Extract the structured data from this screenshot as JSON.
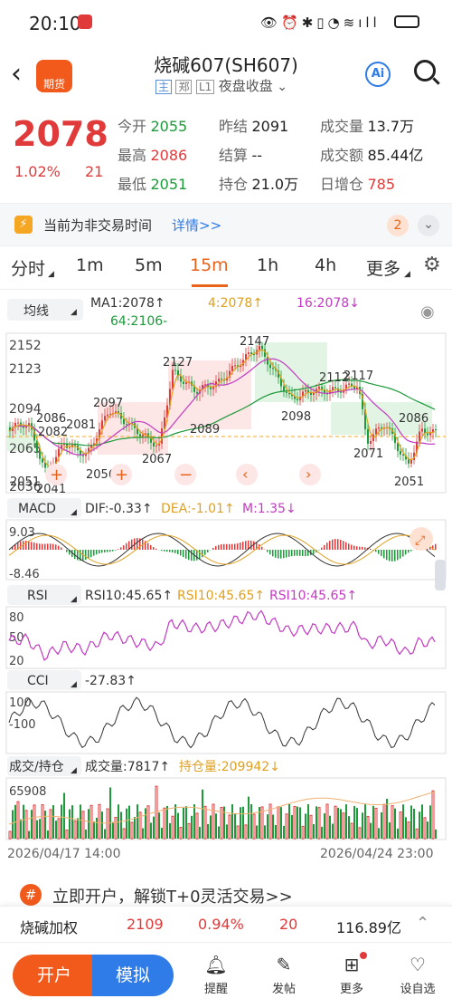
{
  "status_bar": {
    "time": "20:10"
  },
  "header": {
    "title": "烧碱607(SH607)",
    "logo_text": "期货",
    "tag_main": "主",
    "tag_exchange": "郑",
    "tag_level": "L1",
    "session": "夜盘收盘",
    "ai_label": "Ai"
  },
  "quote": {
    "last": "2078",
    "change_pct": "1.02%",
    "change": "21",
    "fields": [
      {
        "label": "今开",
        "value": "2055",
        "color": "green"
      },
      {
        "label": "昨结",
        "value": "2091",
        "color": "black"
      },
      {
        "label": "成交量",
        "value": "13.7万",
        "color": "black"
      },
      {
        "label": "最高",
        "value": "2086",
        "color": "red"
      },
      {
        "label": "结算",
        "value": "--",
        "color": "black"
      },
      {
        "label": "成交额",
        "value": "85.44亿",
        "color": "black"
      },
      {
        "label": "最低",
        "value": "2051",
        "color": "green"
      },
      {
        "label": "持仓",
        "value": "21.0万",
        "color": "black"
      },
      {
        "label": "日增仓",
        "value": "785",
        "color": "red"
      }
    ]
  },
  "notice": {
    "text": "当前为非交易时间",
    "link": "详情>>",
    "badge": "2"
  },
  "periods": [
    "分时",
    "1m",
    "5m",
    "15m",
    "1h",
    "4h",
    "更多"
  ],
  "active_period": "15m",
  "main_chart": {
    "indicator_select": "均线",
    "ma_labels": [
      "MA1:2078↑",
      "4:2078↑",
      "16:2078↓",
      "64:2106-"
    ],
    "axis_labels": [
      "2152",
      "2123",
      "2094",
      "2065",
      "2036"
    ],
    "peak_labels": [
      "2147",
      "2127",
      "2117",
      "2112",
      "2097",
      "2098",
      "2089",
      "2086",
      "2086",
      "2082",
      "2081",
      "2071",
      "2067",
      "2056",
      "2051",
      "2051",
      "2041"
    ],
    "controls": [
      "+",
      "−",
      "‹",
      "›"
    ]
  },
  "macd": {
    "select": "MACD",
    "dif": "DIF:-0.33↑",
    "dea": "DEA:-1.01↑",
    "m": "M:1.35↓",
    "top": "9.03",
    "bottom": "-8.46"
  },
  "rsi": {
    "select": "RSI",
    "r1": "RSI10:45.65↑",
    "r2": "RSI10:45.65↑",
    "r3": "RSI10:45.65↑",
    "levels": [
      "80",
      "50",
      "20"
    ]
  },
  "cci": {
    "select": "CCI",
    "value": "-27.83↑",
    "levels": [
      "100",
      "-100"
    ]
  },
  "volume": {
    "select": "成交/持仓",
    "vol": "成交量:7817↑",
    "oi": "持仓量:209942↓",
    "top": "65908"
  },
  "dates": {
    "start": "2026/04/17 14:00",
    "end": "2026/04/24 23:00"
  },
  "promo": {
    "text": "立即开户，解锁T+0灵活交易>>"
  },
  "index_row": {
    "name": "烧碱加权",
    "price": "2109",
    "pct": "0.94%",
    "change": "20",
    "amount": "116.89亿"
  },
  "bottom_bar": {
    "open_account": "开户",
    "simulate": "模拟",
    "nav": [
      {
        "label": "提醒",
        "icon": "bell-icon"
      },
      {
        "label": "发帖",
        "icon": "edit-icon"
      },
      {
        "label": "更多",
        "icon": "grid-icon"
      },
      {
        "label": "设自选",
        "icon": "heart-plus-icon"
      }
    ]
  },
  "colors": {
    "red": "#e03a3a",
    "green": "#1d9a3a",
    "orange": "#e8641a",
    "blue": "#2f7be8"
  }
}
